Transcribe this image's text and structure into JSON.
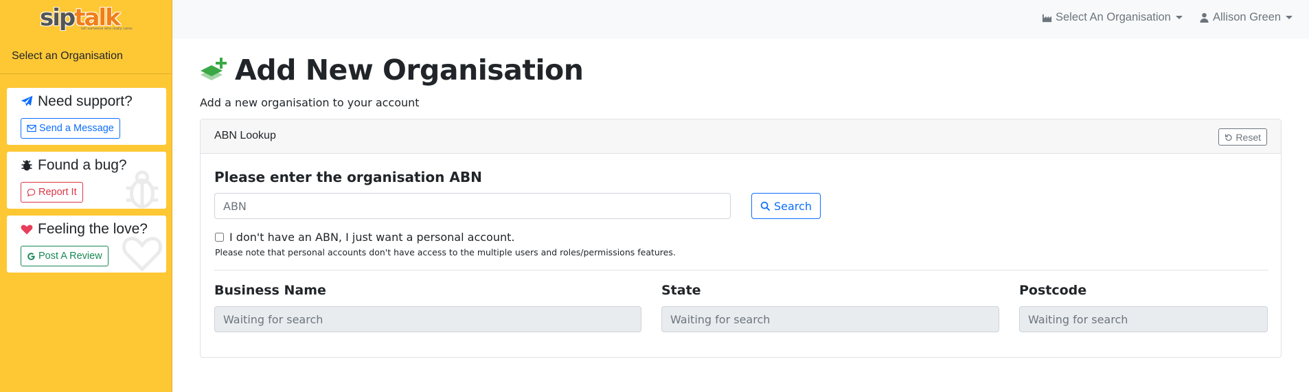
{
  "brand": {
    "sip": "sip",
    "talk": "talk",
    "tagline": "tell someone who really cares"
  },
  "sidebar": {
    "select_label": "Select an Organisation",
    "cards": [
      {
        "title": "Need support?",
        "button": "Send a Message",
        "icon": "paper-plane-icon",
        "button_icon": "envelope-icon"
      },
      {
        "title": "Found a bug?",
        "button": "Report It",
        "icon": "bug-icon",
        "button_icon": "chat-bubble-icon"
      },
      {
        "title": "Feeling the love?",
        "button": "Post A Review",
        "icon": "heart-icon",
        "button_icon": "google-icon"
      }
    ]
  },
  "topbar": {
    "org_select": "Select An Organisation",
    "user": "Allison Green"
  },
  "main": {
    "title": "Add New Organisation",
    "subtitle": "Add a new organisation to your account",
    "panel": {
      "title": "ABN Lookup",
      "reset_label": "Reset",
      "abn_label": "Please enter the organisation ABN",
      "abn_placeholder": "ABN",
      "search_label": "Search",
      "checkbox_label": "I don't have an ABN, I just want a personal account.",
      "checkbox_checked": false,
      "note": "Please note that personal accounts don't have access to the multiple users and roles/permissions features.",
      "fields": [
        {
          "label": "Business Name",
          "placeholder": "Waiting for search"
        },
        {
          "label": "State",
          "placeholder": "Waiting for search"
        },
        {
          "label": "Postcode",
          "placeholder": "Waiting for search"
        }
      ]
    }
  },
  "colors": {
    "sidebar_bg": "#fec835",
    "brand_orange": "#f07e1a",
    "primary": "#0d6efd",
    "danger": "#dc3545",
    "success": "#198754",
    "title_icon_green": "#3aa845"
  }
}
